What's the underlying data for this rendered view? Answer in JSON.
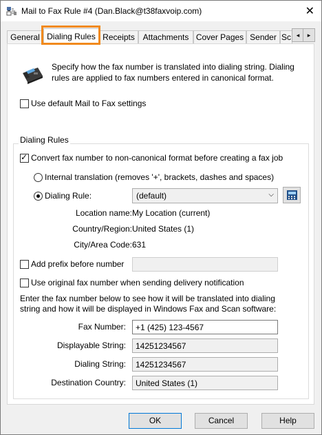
{
  "window": {
    "title": "Mail to Fax Rule #4 (Dan.Black@t38faxvoip.com)",
    "close_glyph": "✕"
  },
  "tabs": [
    "General",
    "Dialing Rules",
    "Receipts",
    "Attachments",
    "Cover Pages",
    "Sender",
    "Sc"
  ],
  "tab_scroll": {
    "left": "◂",
    "right": "▸"
  },
  "intro_text": "Specify how the fax number is translated into dialing string. Dialing rules are applied to fax numbers entered in canonical format.",
  "use_default_label": "Use default Mail to Fax settings",
  "group_title": "Dialing Rules",
  "convert_label": "Convert fax number to non-canonical format before creating a fax job",
  "internal_translation_label": "Internal translation (removes '+', brackets, dashes and spaces)",
  "dialing_rule_label": "Dialing Rule:",
  "dialing_rule_value": "(default)",
  "location": {
    "name_label": "Location name:",
    "name_value": "My Location (current)",
    "country_label": "Country/Region:",
    "country_value": "United States (1)",
    "city_label": "City/Area Code:",
    "city_value": "631"
  },
  "add_prefix_label": "Add prefix before number",
  "add_prefix_value": "",
  "use_original_label": "Use original fax number when sending delivery notification",
  "test_instructions": "Enter the fax number below to see how it will be translated into dialing string and how it will be displayed in Windows Fax and Scan software:",
  "test": {
    "fax_number_label": "Fax Number:",
    "fax_number_value": "+1 (425) 123-4567",
    "displayable_label": "Displayable String:",
    "displayable_value": "14251234567",
    "dialing_label": "Dialing String:",
    "dialing_value": "14251234567",
    "destination_label": "Destination Country:",
    "destination_value": "United States (1)"
  },
  "buttons": {
    "ok": "OK",
    "cancel": "Cancel",
    "help": "Help"
  },
  "colors": {
    "highlight": "#f18a1d",
    "accent": "#0078d7"
  }
}
